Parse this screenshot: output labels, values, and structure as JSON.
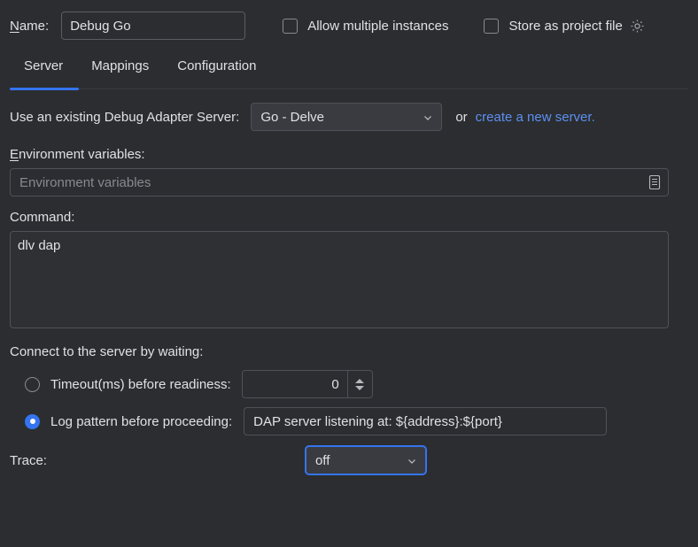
{
  "header": {
    "name_label_mnemonic": "N",
    "name_label_rest": "ame:",
    "name_value": "Debug Go",
    "allow_multiple_label": "Allow multiple instances",
    "store_project_label": "Store as project file",
    "gear_icon": "gear-icon"
  },
  "tabs": [
    {
      "label": "Server",
      "active": true
    },
    {
      "label": "Mappings",
      "active": false
    },
    {
      "label": "Configuration",
      "active": false
    }
  ],
  "server": {
    "adapter_label": "Use an existing Debug Adapter Server:",
    "adapter_value": "Go - Delve",
    "or_text": "or",
    "create_link": "create a new server.",
    "env_label_mnemonic": "E",
    "env_label_rest": "nvironment variables:",
    "env_placeholder": "Environment variables",
    "env_value": "",
    "env_icon": "list-editor-icon",
    "command_label": "Command:",
    "command_value": "dlv dap",
    "connect_label": "Connect to the server by waiting:",
    "timeout_label": "Timeout(ms) before readiness:",
    "timeout_value": "0",
    "log_pattern_label": "Log pattern before proceeding:",
    "log_pattern_value": "DAP server listening at: ${address}:${port}",
    "trace_label": "Trace:",
    "trace_value": "off"
  },
  "colors": {
    "accent": "#3574f0",
    "link": "#5d8ff0",
    "background": "#2b2d30",
    "field_background": "#2f3033",
    "border": "#4e5157"
  }
}
